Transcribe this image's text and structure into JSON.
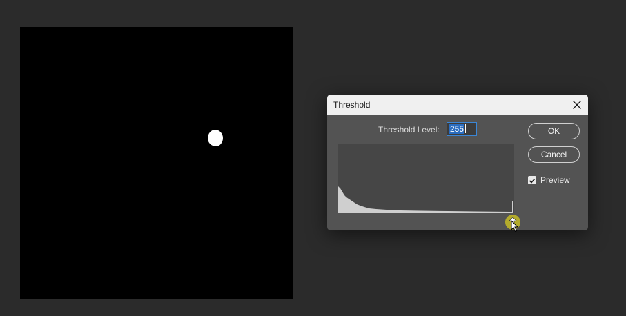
{
  "canvas": {
    "background": "#000000",
    "blob_color": "#ffffff"
  },
  "dialog": {
    "title": "Threshold",
    "close_icon": "close-icon",
    "threshold_label": "Threshold Level:",
    "threshold_value": "255",
    "ok_label": "OK",
    "cancel_label": "Cancel",
    "preview_label": "Preview",
    "preview_checked": true,
    "accent_color": "#3a86d6",
    "slider_marker_color": "#b8b02a"
  }
}
